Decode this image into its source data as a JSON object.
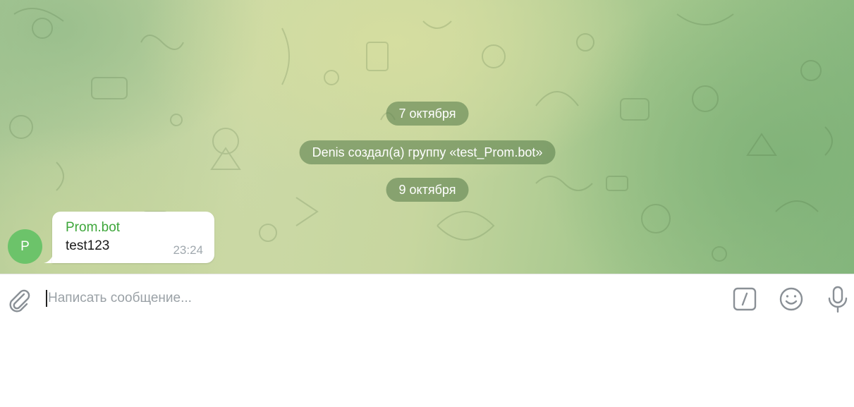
{
  "chat": {
    "service_messages": [
      {
        "text": "7 октября"
      },
      {
        "text": "Denis создал(а) группу «test_Prom.bot»"
      },
      {
        "text": "9 октября"
      }
    ],
    "message": {
      "avatar_letter": "P",
      "avatar_color": "#6cc36a",
      "sender": "Prom.bot",
      "sender_color": "#3da63a",
      "text": "test123",
      "time": "23:24"
    }
  },
  "composer": {
    "placeholder": "Написать сообщение...",
    "value": "",
    "icons": [
      "paperclip-icon",
      "bot-command-icon",
      "emoji-icon",
      "microphone-icon"
    ]
  },
  "colors": {
    "service_pill_bg": "#5f8250",
    "icon_gray": "#8a9096"
  }
}
